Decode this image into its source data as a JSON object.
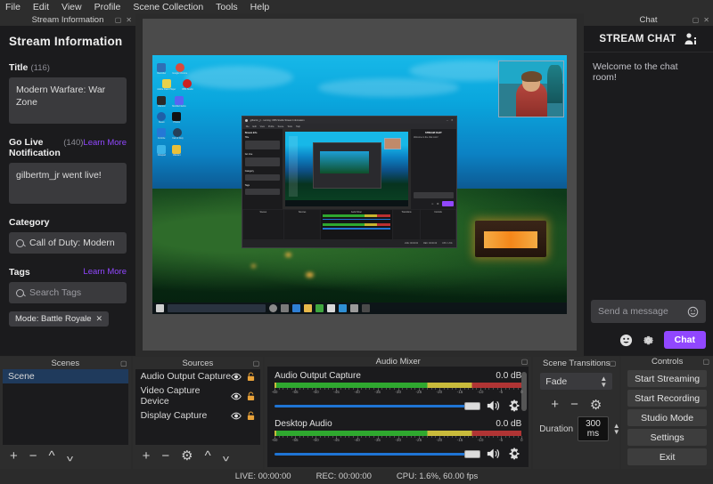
{
  "menubar": {
    "items": [
      "File",
      "Edit",
      "View",
      "Profile",
      "Scene Collection",
      "Tools",
      "Help"
    ]
  },
  "left_dock": {
    "dock_title": "Stream Information",
    "panel_title": "Stream Information",
    "title_field": {
      "label": "Title",
      "count": "(116)",
      "value": "Modern Warfare: War Zone"
    },
    "golive_field": {
      "label": "Go Live Notification",
      "count": "(140)",
      "link": "Learn More",
      "value": "gilbertm_jr went live!"
    },
    "category_field": {
      "label": "Category",
      "value": "Call of Duty: Modern"
    },
    "tags_field": {
      "label": "Tags",
      "link": "Learn More",
      "placeholder": "Search Tags",
      "chip": "Mode: Battle Royale",
      "chip_close": "✕"
    }
  },
  "chat_dock": {
    "dock_title": "Chat",
    "header": "STREAM CHAT",
    "header_icon": "community-user-icon",
    "welcome": "Welcome to the chat room!",
    "input_placeholder": "Send a message",
    "input_icon": "emote-circle-icon",
    "actions": {
      "emote": "emote-icon",
      "settings": "gear-icon",
      "send_label": "Chat"
    },
    "accent": "#9147ff"
  },
  "scenes_dock": {
    "title": "Scenes",
    "items": [
      {
        "name": "Scene",
        "selected": true
      }
    ],
    "tools": [
      "add-icon",
      "remove-icon",
      "move-up-icon",
      "move-down-icon"
    ]
  },
  "sources_dock": {
    "title": "Sources",
    "items": [
      {
        "name": "Audio Output Capture",
        "visible": true,
        "locked": true
      },
      {
        "name": "Video Capture Device",
        "visible": true,
        "locked": true
      },
      {
        "name": "Display Capture",
        "visible": true,
        "locked": true
      }
    ],
    "tools": [
      "add-icon",
      "remove-icon",
      "gear-icon",
      "move-up-icon",
      "move-down-icon"
    ]
  },
  "audio_mixer": {
    "title": "Audio Mixer",
    "scale_ticks": [
      -60,
      -55,
      -50,
      -45,
      -40,
      -35,
      -30,
      -25,
      -20,
      -15,
      -10,
      -5,
      0
    ],
    "channels": [
      {
        "name": "Audio Output Capture",
        "db": "0.0 dB",
        "volume_percent": 100,
        "muted": false
      },
      {
        "name": "Desktop Audio",
        "db": "0.0 dB",
        "volume_percent": 100,
        "muted": false
      }
    ],
    "meter_colors": {
      "green": "#2fa82f",
      "yellow": "#c9bb3b",
      "red": "#b03434",
      "slider": "#1f74d4"
    }
  },
  "scene_transitions": {
    "title": "Scene Transitions",
    "transition": "Fade",
    "duration_label": "Duration",
    "duration_value": "300 ms",
    "tools": [
      "add-icon",
      "remove-icon",
      "gear-icon"
    ]
  },
  "controls": {
    "title": "Controls",
    "buttons": [
      "Start Streaming",
      "Start Recording",
      "Studio Mode",
      "Settings",
      "Exit"
    ]
  },
  "status_bar": {
    "live": "LIVE: 00:00:00",
    "rec": "REC: 00:00:00",
    "cpu": "CPU: 1.6%, 60.00 fps"
  },
  "preview": {
    "desktop_icons": [
      "Recorder",
      "Google Chrome",
      "Adobe Flash Player",
      "OBS Studio",
      "Discord",
      "Mozilla Firefox",
      "Steam",
      "Photos",
      "Fortnite",
      "Call of Duty",
      "Notepad",
      "Valorant"
    ],
    "nested_window_title": "gilbertm_jr - running: OBS Studio  Stream Information",
    "taskbar_search": "Type here to search"
  }
}
